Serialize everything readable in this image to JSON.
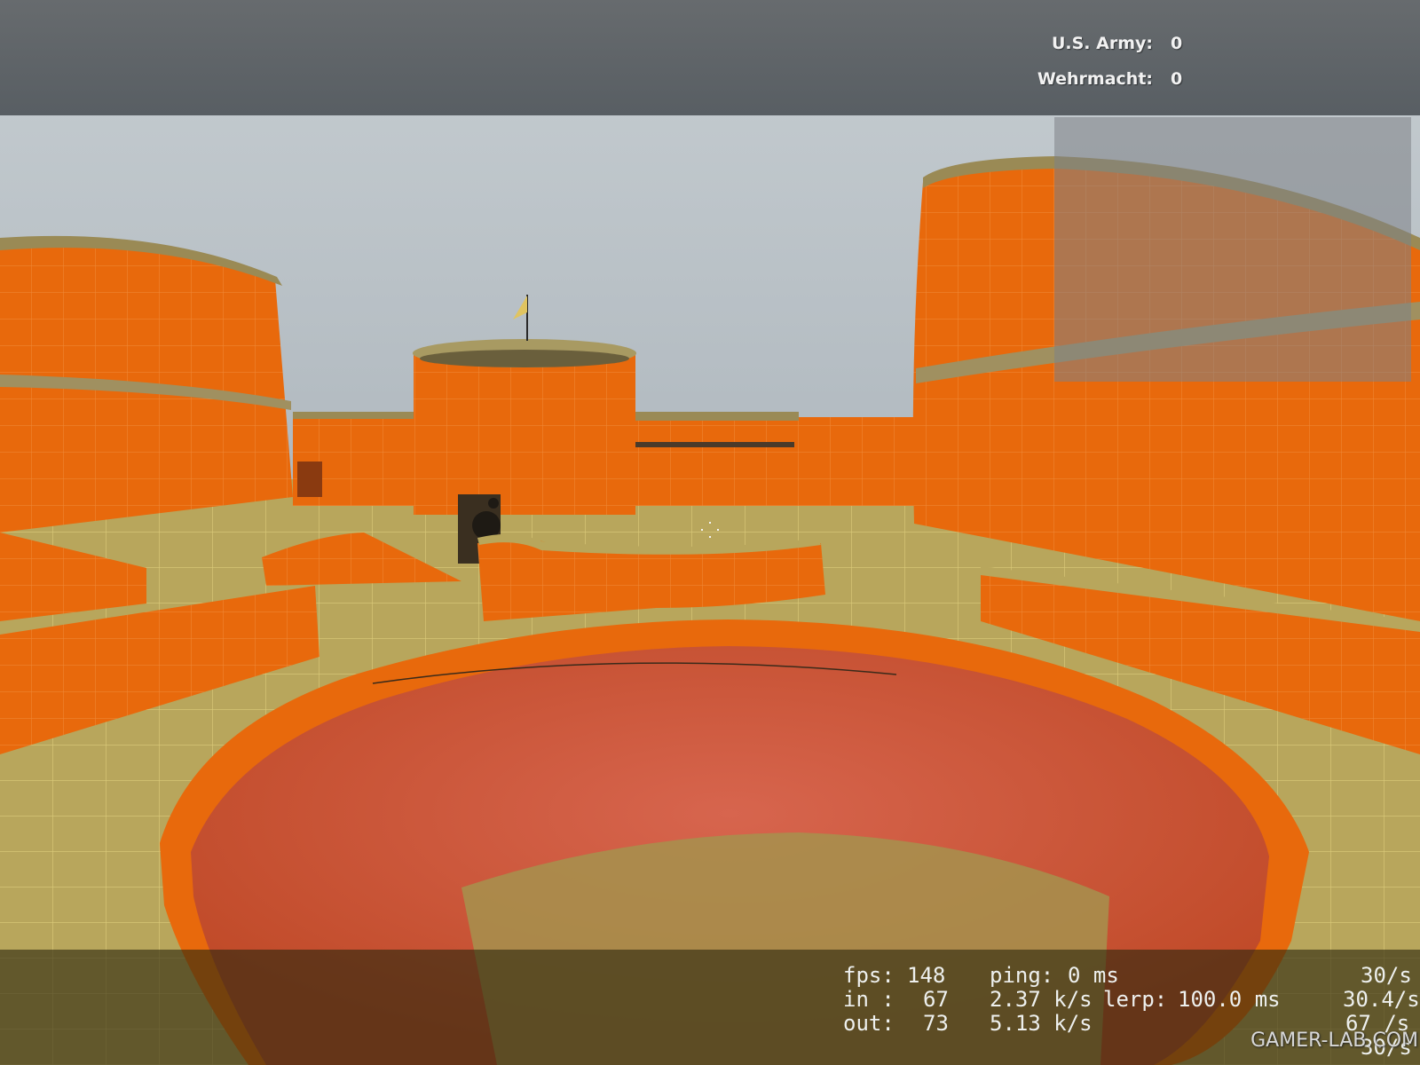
{
  "scoreboard": {
    "teams": [
      {
        "name": "U.S. Army:",
        "score": "0"
      },
      {
        "name": "Wehrmacht:",
        "score": "0"
      }
    ]
  },
  "net_graph": {
    "fps_label": "fps:",
    "fps_value": "148",
    "ping_label": "ping:",
    "ping_value": "0 ms",
    "rate_col_top": "30/s",
    "in_label": "in :",
    "in_value": "67",
    "in_rate": "2.37 k/s",
    "lerp_label": "lerp:",
    "lerp_value": "100.0 ms",
    "rate_col_mid": "30.4/s",
    "out_label": "out:",
    "out_value": "73",
    "out_rate": "5.13 k/s",
    "rate_col_bottom": "67 /s",
    "rate_col_extra": "30/s"
  },
  "watermark": "GAMER-LAB.COM",
  "colors": {
    "sky": "#c8cfd2",
    "wall_orange": "#e86a0c",
    "floor_khaki": "#b6a45a",
    "trim_tan": "#9a8a55",
    "water": "#d0563a"
  }
}
